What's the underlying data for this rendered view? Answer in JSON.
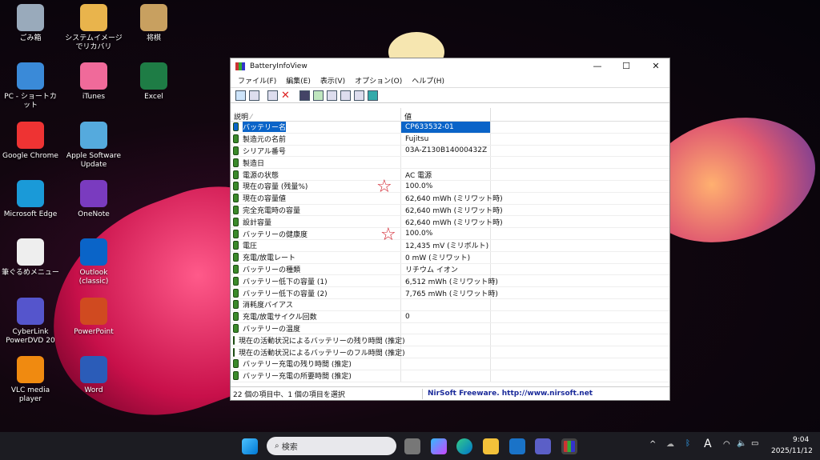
{
  "desktop": {
    "icons": [
      "ごみ箱",
      "システムイメージでリカバリ",
      "将棋",
      "PC - ショートカット",
      "iTunes",
      "Excel",
      "Google Chrome",
      "Apple Software Update",
      "Microsoft Edge",
      "OneNote",
      "筆ぐるめメニュー",
      "Outlook (classic)",
      "CyberLink PowerDVD 20",
      "PowerPoint",
      "VLC media player",
      "Word"
    ]
  },
  "window": {
    "title": "BatteryInfoView",
    "minimize": "—",
    "maximize": "☐",
    "close": "✕",
    "menu": [
      "ファイル(F)",
      "編集(E)",
      "表示(V)",
      "オプション(O)",
      "ヘルプ(H)"
    ],
    "columns": [
      "説明",
      "値"
    ],
    "sort_indicator": "⁄",
    "rows": [
      {
        "name": "バッテリー名",
        "value": "CP633532-01"
      },
      {
        "name": "製造元の名前",
        "value": "Fujitsu"
      },
      {
        "name": "シリアル番号",
        "value": "03A-Z130B14000432Z"
      },
      {
        "name": "製造日",
        "value": ""
      },
      {
        "name": "電源の状態",
        "value": "AC 電源"
      },
      {
        "name": "現在の容量 (残量%)",
        "value": "100.0%"
      },
      {
        "name": "現在の容量値",
        "value": "62,640 mWh (ミリワット時)"
      },
      {
        "name": "完全充電時の容量",
        "value": "62,640 mWh (ミリワット時)"
      },
      {
        "name": "設計容量",
        "value": "62,640 mWh (ミリワット時)"
      },
      {
        "name": "バッテリーの健康度",
        "value": "100.0%"
      },
      {
        "name": "電圧",
        "value": "12,435 mV (ミリボルト)"
      },
      {
        "name": "充電/放電レート",
        "value": "0 mW (ミリワット)"
      },
      {
        "name": "バッテリーの種類",
        "value": "リチウム イオン"
      },
      {
        "name": "バッテリー低下の容量 (1)",
        "value": "6,512 mWh (ミリワット時)"
      },
      {
        "name": "バッテリー低下の容量 (2)",
        "value": "7,765 mWh (ミリワット時)"
      },
      {
        "name": "消耗度バイアス",
        "value": ""
      },
      {
        "name": "充電/放電サイクル回数",
        "value": "0"
      },
      {
        "name": "バッテリーの温度",
        "value": ""
      },
      {
        "name": "現在の活動状況によるバッテリーの残り時間 (推定)",
        "value": ""
      },
      {
        "name": "現在の活動状況によるバッテリーのフル時間 (推定)",
        "value": ""
      },
      {
        "name": "バッテリー充電の残り時間 (推定)",
        "value": ""
      },
      {
        "name": "バッテリー充電の所要時間 (推定)",
        "value": ""
      }
    ],
    "status_left": "22 個の項目中、1 個の項目を選択",
    "status_right": "NirSoft Freeware.  http://www.nirsoft.net",
    "star": "☆"
  },
  "taskbar": {
    "search_placeholder": "検索",
    "time": "9:04",
    "date": "2025/11/12",
    "ime": "A",
    "chevron": "^"
  }
}
